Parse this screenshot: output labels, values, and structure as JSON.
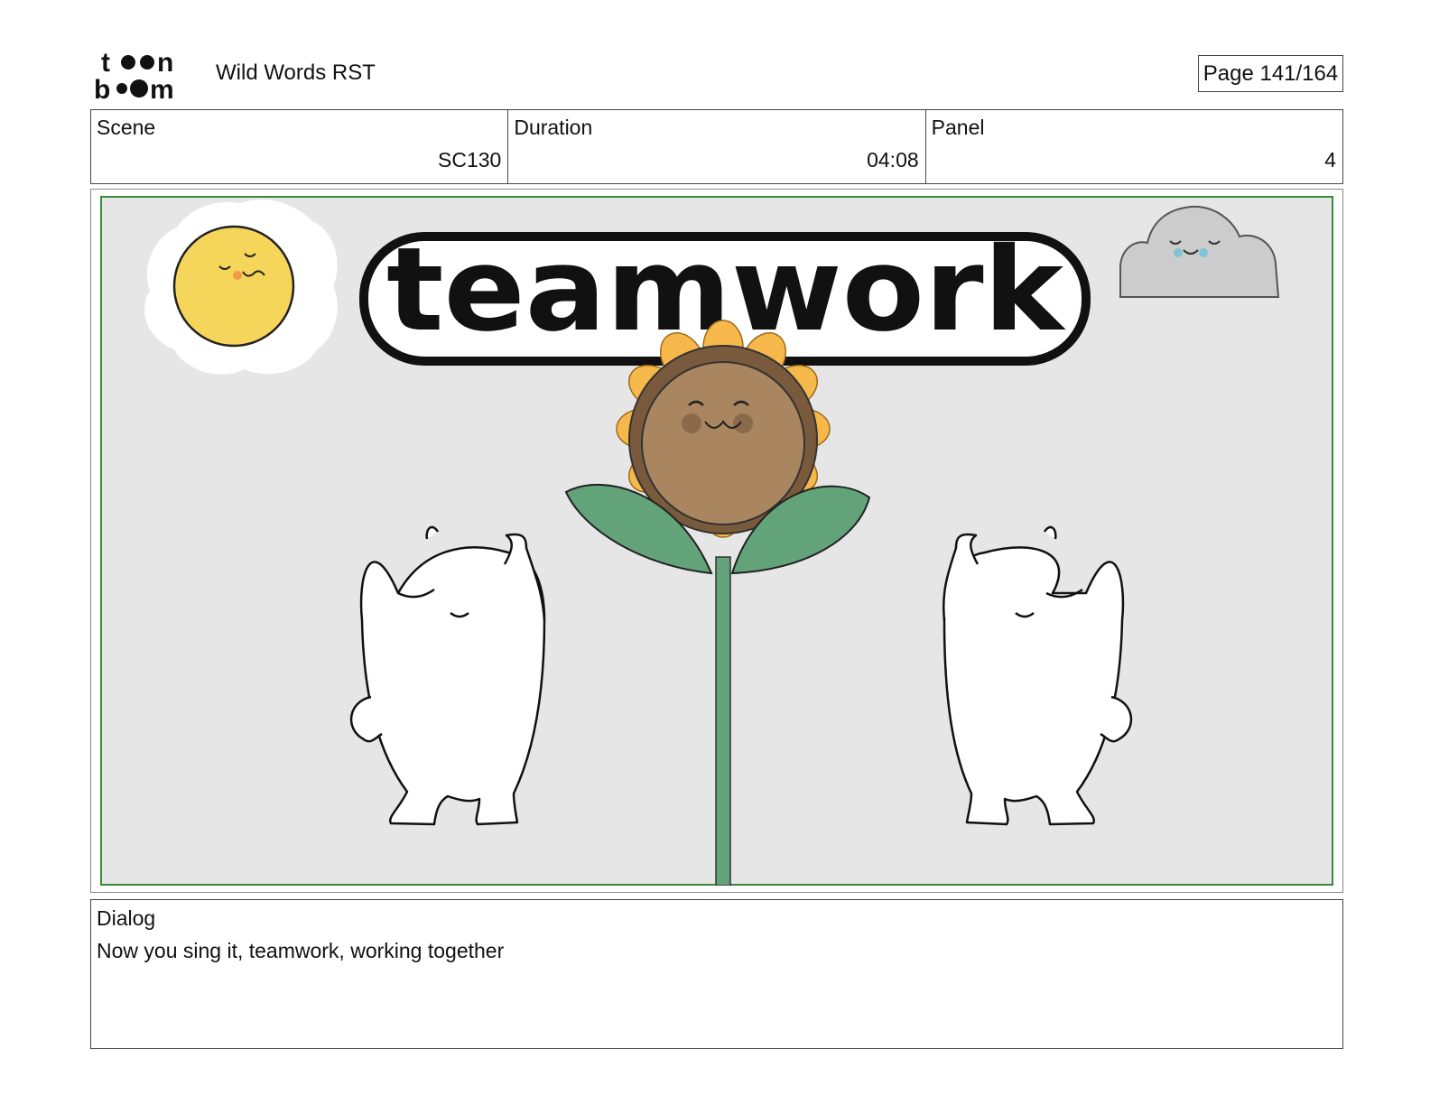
{
  "header": {
    "logo_text": "toon boom",
    "project_title": "Wild Words RST",
    "page_label": "Page 141/164"
  },
  "info": {
    "scene_label": "Scene",
    "scene_value": "SC130",
    "duration_label": "Duration",
    "duration_value": "04:08",
    "panel_label": "Panel",
    "panel_value": "4"
  },
  "panel": {
    "title_word": "teamwork",
    "background_color": "#e6e6e6",
    "frame_color": "#3a8a3a",
    "sun_color": "#f5d55a",
    "petal_color": "#f6b84a",
    "seed_color": "#a98660",
    "leaf_color": "#62a379",
    "cloud_color": "#cccccc"
  },
  "dialog": {
    "label": "Dialog",
    "text": "Now you sing it, teamwork, working together"
  }
}
